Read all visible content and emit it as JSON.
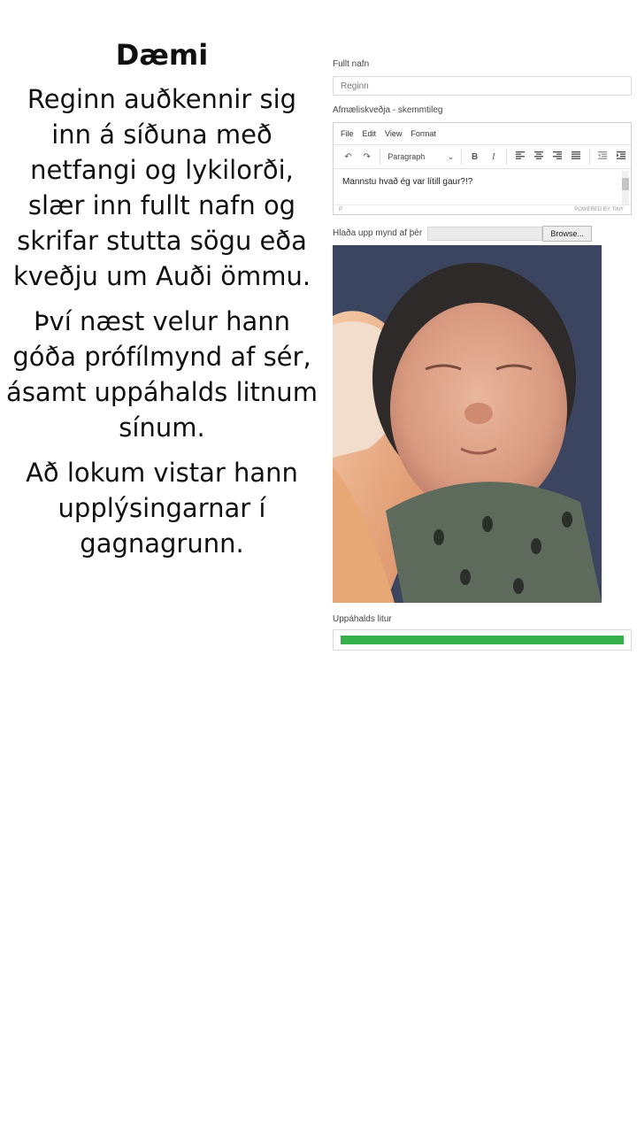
{
  "intro": {
    "title": "Dæmi",
    "paragraphs": [
      "Reginn auðkennir sig inn á síðuna með netfangi og lykilorði, slær inn fullt nafn og skrifar stutta sögu eða kveðju um Auði ömmu.",
      "Því næst velur hann góða prófílmynd af sér, ásamt uppáhalds litnum sínum.",
      "Að lokum vistar hann upplýsingarnar í gagnagrunn."
    ]
  },
  "form": {
    "name_label": "Fullt nafn",
    "name_value": "Reginn",
    "greeting_label": "Afmæliskveðja - skemmtileg",
    "editor": {
      "menu": [
        "File",
        "Edit",
        "View",
        "Format"
      ],
      "format_select": "Paragraph",
      "content": "Mannstu hvað ég var lítill gaur?!?",
      "status_path": "P",
      "powered_by": "POWERED BY TINY"
    },
    "upload_label": "Hlaða upp mynd af þér",
    "browse_label": "Browse...",
    "color_label": "Uppáhalds litur",
    "color_value": "#35b04a"
  },
  "icons": {
    "undo": "undo-icon",
    "redo": "redo-icon",
    "bold": "bold-icon",
    "italic": "italic-icon",
    "align_left": "align-left-icon",
    "align_center": "align-center-icon",
    "align_right": "align-right-icon",
    "align_justify": "align-justify-icon",
    "outdent": "outdent-icon",
    "indent": "indent-icon"
  }
}
